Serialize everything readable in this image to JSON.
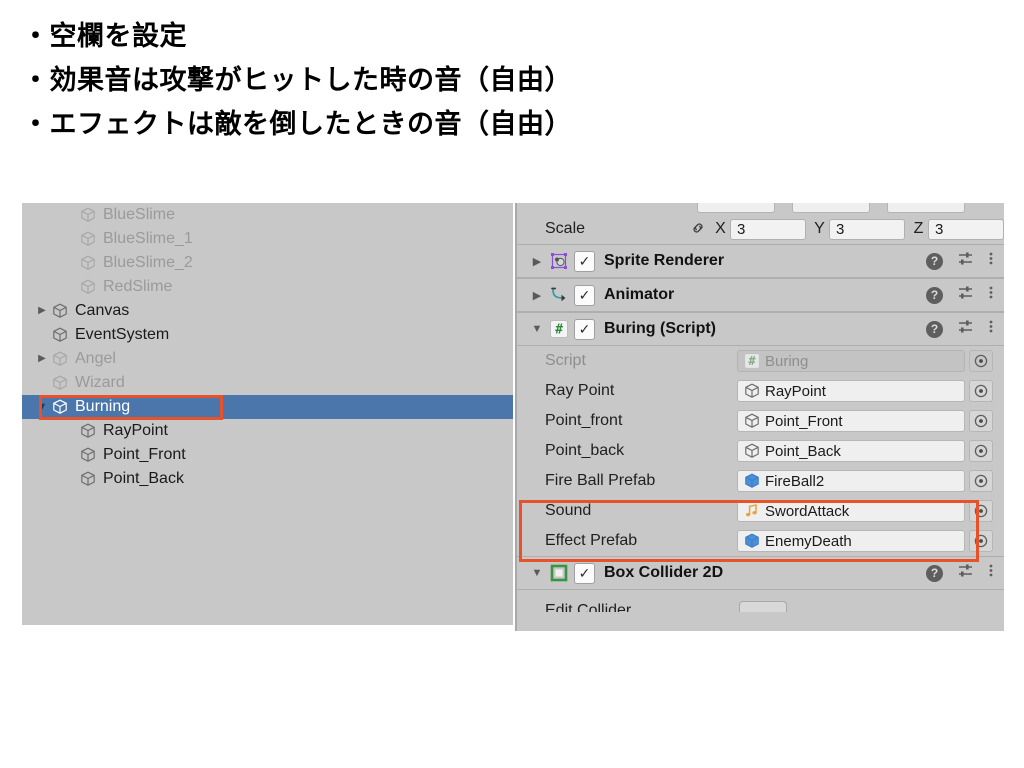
{
  "slide": {
    "bullets": [
      "・空欄を設定",
      "・効果音は攻撃がヒットした時の音（自由）",
      "・エフェクトは敵を倒したときの音（自由）"
    ]
  },
  "hierarchy": {
    "items": [
      {
        "label": "BlueSlime",
        "indent": 1,
        "arrow": "",
        "state": "inactive",
        "icon": "gameobject-cube-icon"
      },
      {
        "label": "BlueSlime_1",
        "indent": 1,
        "arrow": "",
        "state": "inactive",
        "icon": "gameobject-cube-icon"
      },
      {
        "label": "BlueSlime_2",
        "indent": 1,
        "arrow": "",
        "state": "inactive",
        "icon": "gameobject-cube-icon"
      },
      {
        "label": "RedSlime",
        "indent": 1,
        "arrow": "",
        "state": "inactive",
        "icon": "gameobject-cube-icon"
      },
      {
        "label": "Canvas",
        "indent": 0,
        "arrow": "▶",
        "state": "active",
        "icon": "gameobject-cube-icon"
      },
      {
        "label": "EventSystem",
        "indent": 0,
        "arrow": "",
        "state": "active",
        "icon": "gameobject-cube-icon"
      },
      {
        "label": "Angel",
        "indent": 0,
        "arrow": "▶",
        "state": "inactive",
        "icon": "gameobject-cube-icon"
      },
      {
        "label": "Wizard",
        "indent": 0,
        "arrow": "",
        "state": "inactive",
        "icon": "gameobject-cube-icon"
      },
      {
        "label": "Burning",
        "indent": 0,
        "arrow": "▼",
        "state": "selected",
        "icon": "gameobject-cube-icon"
      },
      {
        "label": "RayPoint",
        "indent": 1,
        "arrow": "",
        "state": "active",
        "icon": "gameobject-cube-icon"
      },
      {
        "label": "Point_Front",
        "indent": 1,
        "arrow": "",
        "state": "active",
        "icon": "gameobject-cube-icon"
      },
      {
        "label": "Point_Back",
        "indent": 1,
        "arrow": "",
        "state": "active",
        "icon": "gameobject-cube-icon"
      }
    ]
  },
  "inspector": {
    "transform": {
      "scale_label": "Scale",
      "link_icon": "link-icon",
      "axes": [
        {
          "letter": "X",
          "value": "3"
        },
        {
          "letter": "Y",
          "value": "3"
        },
        {
          "letter": "Z",
          "value": "3"
        }
      ]
    },
    "components": [
      {
        "title": "Sprite Renderer",
        "foldout": "▶",
        "icon": "sprite-renderer-icon",
        "enabled": true
      },
      {
        "title": "Animator",
        "foldout": "▶",
        "icon": "animator-icon",
        "enabled": true
      },
      {
        "title": "Buring (Script)",
        "foldout": "▼",
        "icon": "csharp-script-icon",
        "enabled": true
      },
      {
        "title": "Box Collider 2D",
        "foldout": "▼",
        "icon": "box-collider-2d-icon",
        "enabled": true
      }
    ],
    "script_properties": [
      {
        "label": "Script",
        "value": "Buring",
        "icon": "csharp-script-icon",
        "dim": true,
        "highlight": false
      },
      {
        "label": "Ray Point",
        "value": "RayPoint",
        "icon": "gameobject-cube-icon",
        "dim": false,
        "highlight": false
      },
      {
        "label": "Point_front",
        "value": "Point_Front",
        "icon": "gameobject-cube-icon",
        "dim": false,
        "highlight": false
      },
      {
        "label": "Point_back",
        "value": "Point_Back",
        "icon": "gameobject-cube-icon",
        "dim": false,
        "highlight": false
      },
      {
        "label": "Fire Ball Prefab",
        "value": "FireBall2",
        "icon": "prefab-cube-icon",
        "dim": false,
        "highlight": false
      },
      {
        "label": "Sound",
        "value": "SwordAttack",
        "icon": "audio-clip-icon",
        "dim": false,
        "highlight": true
      },
      {
        "label": "Effect Prefab",
        "value": "EnemyDeath",
        "icon": "prefab-cube-icon",
        "dim": false,
        "highlight": true
      }
    ],
    "clipped_bottom_label": "Edit Collider",
    "header_actions": {
      "help": "?",
      "help_icon": "help-icon",
      "preset_icon": "preset-settings-icon",
      "menu_icon": "kebab-menu-icon"
    },
    "checkbox_glyph": "✓",
    "picker_icon": "object-picker-icon"
  },
  "colors": {
    "panel_background": "#c8c8c8",
    "selection_blue": "#4a76ab",
    "highlight_orange": "#e8522a",
    "field_background": "#efefef",
    "prefab_blue": "#4a90d9",
    "audio_amber": "#e8a33d",
    "script_green": "#2e8b3e",
    "collider_green": "#3a9442"
  }
}
